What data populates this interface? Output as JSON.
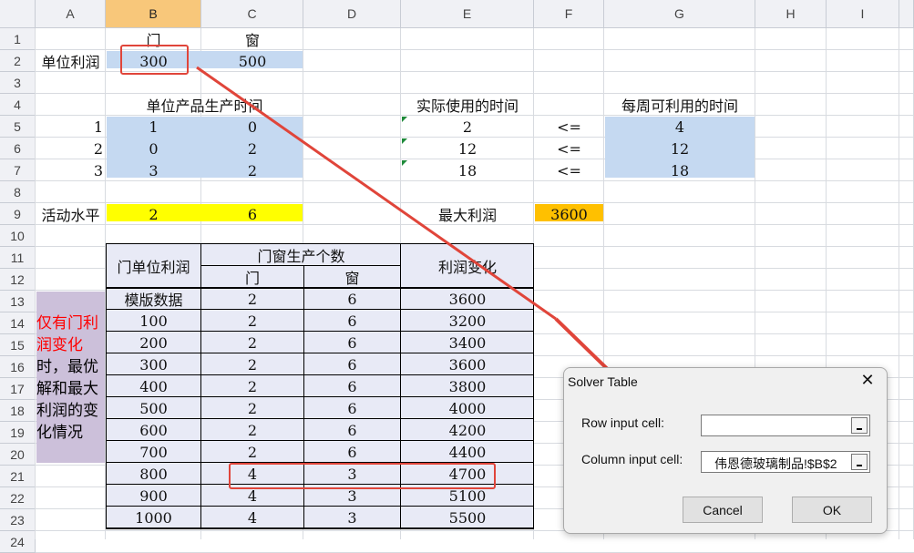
{
  "column_headers": [
    "A",
    "B",
    "C",
    "D",
    "E",
    "F",
    "G",
    "H",
    "I"
  ],
  "row_headers": [
    "1",
    "2",
    "3",
    "4",
    "5",
    "6",
    "7",
    "8",
    "9",
    "10",
    "11",
    "12",
    "13",
    "14",
    "15",
    "16",
    "17",
    "18",
    "19",
    "20",
    "21",
    "22",
    "23",
    "24"
  ],
  "sheet": {
    "row1": {
      "b": "门",
      "c": "窗"
    },
    "row2": {
      "a": "单位利润",
      "b": "300",
      "c": "500"
    },
    "row4": {
      "bc": "单位产品生产时间",
      "e": "实际使用的时间",
      "g": "每周可利用的时间"
    },
    "constraints": [
      {
        "a": "1",
        "b": "1",
        "c": "0",
        "e": "2",
        "f": "<=",
        "g": "4"
      },
      {
        "a": "2",
        "b": "0",
        "c": "2",
        "e": "12",
        "f": "<=",
        "g": "12"
      },
      {
        "a": "3",
        "b": "3",
        "c": "2",
        "e": "18",
        "f": "<=",
        "g": "18"
      }
    ],
    "row9": {
      "a": "活动水平",
      "b": "2",
      "c": "6",
      "e": "最大利润",
      "f": "3600"
    },
    "table_headers": {
      "unit_profit": "门单位利润",
      "count": "门窗生产个数",
      "door": "门",
      "window": "窗",
      "profit_change": "利润变化"
    },
    "table_rows": [
      {
        "b": "模版数据",
        "c": "2",
        "d": "6",
        "e": "3600"
      },
      {
        "b": "100",
        "c": "2",
        "d": "6",
        "e": "3200"
      },
      {
        "b": "200",
        "c": "2",
        "d": "6",
        "e": "3400"
      },
      {
        "b": "300",
        "c": "2",
        "d": "6",
        "e": "3600"
      },
      {
        "b": "400",
        "c": "2",
        "d": "6",
        "e": "3800"
      },
      {
        "b": "500",
        "c": "2",
        "d": "6",
        "e": "4000"
      },
      {
        "b": "600",
        "c": "2",
        "d": "6",
        "e": "4200"
      },
      {
        "b": "700",
        "c": "2",
        "d": "6",
        "e": "4400"
      },
      {
        "b": "800",
        "c": "4",
        "d": "3",
        "e": "4700"
      },
      {
        "b": "900",
        "c": "4",
        "d": "3",
        "e": "5100"
      },
      {
        "b": "1000",
        "c": "4",
        "d": "3",
        "e": "5500"
      }
    ],
    "note_lines": [
      "仅有门利",
      "润变化",
      "时，最优",
      "解和最大",
      "利润的变",
      "化情况"
    ]
  },
  "dialog": {
    "title": "Solver Table",
    "close": "✕",
    "row_input_label": "Row input cell:",
    "row_input_value": "",
    "column_input_label": "Column input cell:",
    "column_input_value": "伟恩德玻璃制品!$B$2",
    "cancel": "Cancel",
    "ok": "OK"
  },
  "colors": {
    "selected_header": "#f8c77a",
    "blue_fill": "#c5d9f1",
    "yellow_fill": "#ffff00",
    "orange_fill": "#ffc000",
    "table_fill": "#e8eaf6",
    "note_fill": "#ccc0da",
    "note_red": "#ff0000",
    "annotation_red": "#e0453a"
  }
}
